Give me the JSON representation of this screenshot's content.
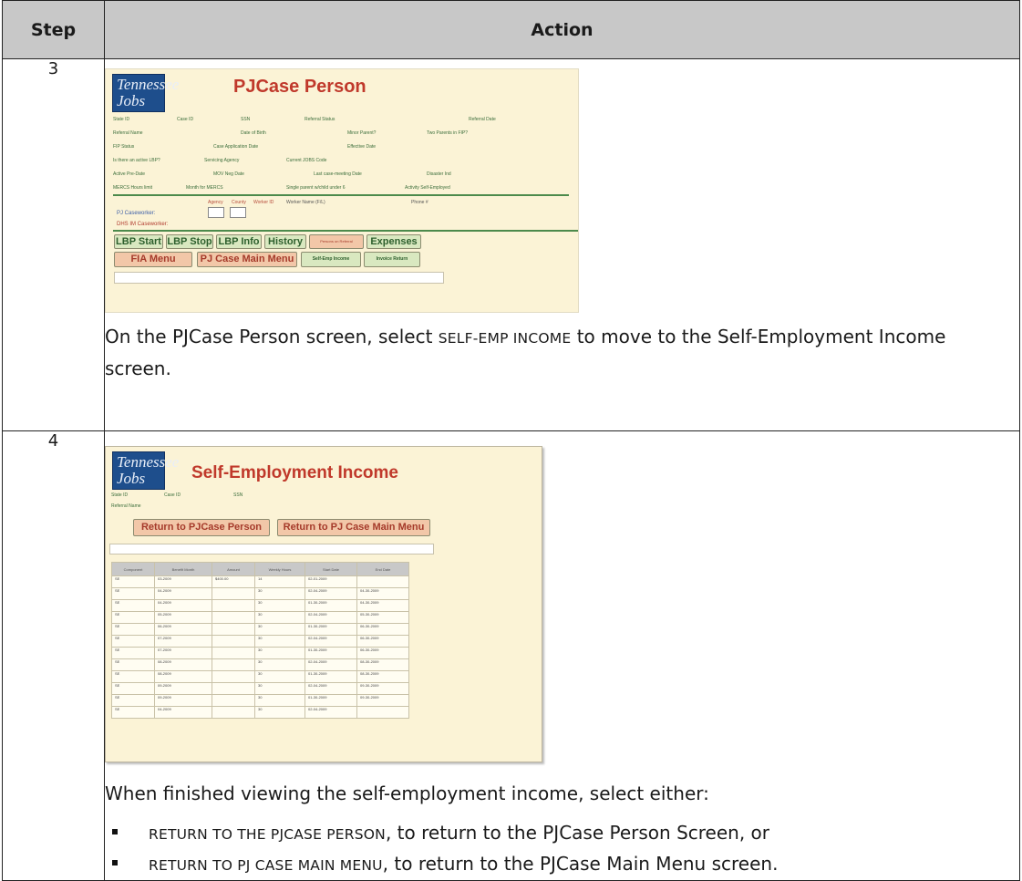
{
  "table": {
    "header_step": "Step",
    "header_action": "Action"
  },
  "steps": [
    {
      "number": "3",
      "screen": {
        "logo_text": "Tennessee Jobs",
        "title": "PJCase Person",
        "field_labels": [
          "State ID",
          "Case ID",
          "SSN",
          "Referral Status",
          "Referral Date",
          "Referral Name",
          "Date of Birth",
          "Minor Parent?",
          "Two Parents in FIP?",
          "FIP Status",
          "Case Application Date",
          "Effective Date",
          "Is there an active LBP?",
          "Servicing Agency",
          "Current JOBS Code",
          "Active Pre-Date",
          "MOV Neg Date",
          "Last case-meeting Date",
          "Disaster Ind",
          "MERCS Hours limit",
          "Month for MERCS",
          "Single parent w/child under 6",
          "Activity Self-Employed"
        ],
        "worker_labels": [
          "Agency",
          "County",
          "Worker ID",
          "Worker Name (F/L)",
          "Phone #"
        ],
        "pj_caseworker": "PJ Caseworker:",
        "dhs_caseworker": "DHS IM Caseworker:",
        "buttons_row1": [
          "LBP Start",
          "LBP Stop",
          "LBP Info",
          "History",
          "Persons on Referral",
          "Expenses"
        ],
        "buttons_row2": [
          "FIA Menu",
          "PJ Case Main Menu",
          "Self-Emp Income",
          "Invoice Return"
        ]
      },
      "desc_before": "On the PJCase Person screen, select ",
      "desc_action": "SELF-EMP INCOME",
      "desc_after": " to move to the Self-Employment Income screen."
    },
    {
      "number": "4",
      "screen": {
        "logo_text": "Tennessee Jobs",
        "title": "Self-Employment Income",
        "field_labels": [
          "State ID",
          "Case ID",
          "SSN",
          "Referral Name"
        ],
        "btn_return_person": "Return to PJCase Person",
        "btn_return_menu": "Return to PJ Case Main Menu",
        "columns": [
          "Component",
          "Benefit Month",
          "Amount",
          "Weekly Hours",
          "Start Date",
          "End Date"
        ],
        "rows": [
          [
            "SE",
            "03-2009",
            "$400.00",
            "14",
            "02-01-2009",
            ""
          ],
          [
            "SE",
            "04-2009",
            "",
            "30",
            "02-04-2009",
            "04-30-2009"
          ],
          [
            "SE",
            "04-2009",
            "",
            "30",
            "01-30-2009",
            "04-30-2009"
          ],
          [
            "SE",
            "05-2009",
            "",
            "30",
            "02-04-2009",
            "05-30-2009"
          ],
          [
            "SE",
            "06-2009",
            "",
            "30",
            "01-30-2009",
            "06-30-2009"
          ],
          [
            "SE",
            "07-2009",
            "",
            "30",
            "02-04-2009",
            "06-30-2009"
          ],
          [
            "SE",
            "07-2009",
            "",
            "30",
            "01-30-2009",
            "06-30-2009"
          ],
          [
            "SE",
            "08-2009",
            "",
            "30",
            "02-04-2009",
            "08-30-2009"
          ],
          [
            "SE",
            "08-2009",
            "",
            "30",
            "01-30-2009",
            "08-30-2009"
          ],
          [
            "SE",
            "09-2009",
            "",
            "30",
            "02-04-2009",
            "09-30-2009"
          ],
          [
            "SE",
            "09-2009",
            "",
            "30",
            "01-30-2009",
            "09-30-2009"
          ],
          [
            "SE",
            "04-2009",
            "",
            "30",
            "02-04-2009",
            ""
          ]
        ]
      },
      "desc_intro": "When finished viewing the self-employment income, select either:",
      "options": [
        {
          "action": "RETURN TO THE PJCASE PERSON",
          "text": ", to return to the PJCase Person Screen, or"
        },
        {
          "action": "RETURN TO PJ CASE MAIN MENU",
          "text": ", to return to the PJCase Main Menu screen."
        }
      ]
    }
  ]
}
